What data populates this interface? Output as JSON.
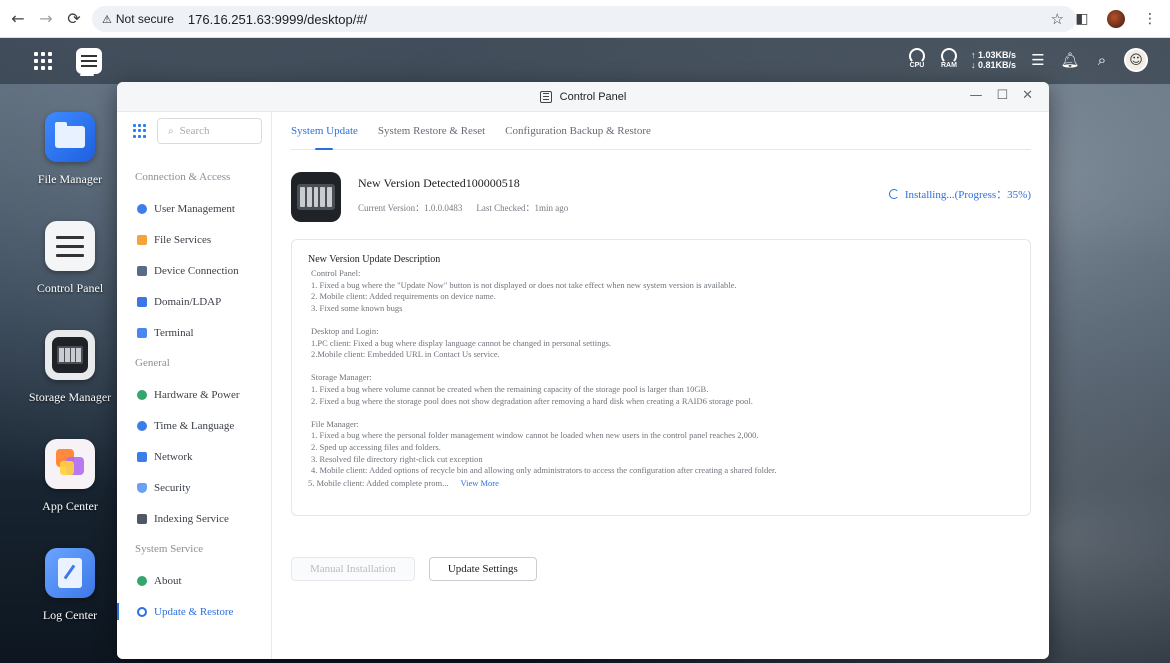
{
  "browser": {
    "security_label": "Not secure",
    "url": "176.16.251.63:9999/desktop/#/"
  },
  "topbar": {
    "cpu_label": "CPU",
    "ram_label": "RAM",
    "upload_speed": "↑ 1.03KB/s",
    "download_speed": "↓ 0.81KB/s"
  },
  "desktop_icons": [
    {
      "label": "File Manager"
    },
    {
      "label": "Control Panel"
    },
    {
      "label": "Storage Manager"
    },
    {
      "label": "App Center"
    },
    {
      "label": "Log Center"
    }
  ],
  "window": {
    "title": "Control Panel"
  },
  "sidebar": {
    "search_placeholder": "Search",
    "sections": [
      {
        "title": "Connection & Access",
        "items": [
          "User Management",
          "File Services",
          "Device Connection",
          "Domain/LDAP",
          "Terminal"
        ]
      },
      {
        "title": "General",
        "items": [
          "Hardware & Power",
          "Time & Language",
          "Network",
          "Security",
          "Indexing Service"
        ]
      },
      {
        "title": "System Service",
        "items": [
          "About",
          "Update & Restore"
        ]
      }
    ]
  },
  "tabs": [
    "System Update",
    "System Restore & Reset",
    "Configuration Backup & Restore"
  ],
  "update": {
    "title": "New Version Detected100000518",
    "current_version": "Current Version：1.0.0.0483",
    "last_checked": "Last Checked：1min ago",
    "progress_text": "Installing...(Progress：35%)",
    "progress_value": 35
  },
  "description": {
    "title": "New Version Update Description",
    "lines": [
      "Control Panel:",
      "1. Fixed a bug where the \"Update Now\" button is not displayed or does not take effect when new system version is available.",
      "2. Mobile client: Added requirements on device name.",
      "3. Fixed some known bugs",
      "",
      "Desktop and Login:",
      "1.PC client: Fixed a bug where display language cannot be changed in personal settings.",
      "2.Mobile client: Embedded URL in Contact Us service.",
      "",
      "Storage Manager:",
      "1. Fixed a bug where volume cannot be created when the remaining capacity of the storage pool is larger than 10GB.",
      "2. Fixed a bug where the storage pool does not show degradation after removing a hard disk when creating a RAID6 storage pool.",
      "",
      "File Manager:",
      "1. Fixed a bug where the personal folder management window cannot be loaded when new users in the control panel reaches 2,000.",
      "2. Sped up accessing files and folders.",
      "3. Resolved file directory right-click cut exception",
      "4. Mobile client: Added options of recycle bin and allowing only administrators to access the configuration after creating a shared folder."
    ],
    "last_line": "5. Mobile client: Added complete prom...",
    "view_more": "View More"
  },
  "buttons": {
    "manual_install": "Manual Installation",
    "update_settings": "Update Settings"
  },
  "colors": {
    "accent": "#2b6fe0"
  }
}
